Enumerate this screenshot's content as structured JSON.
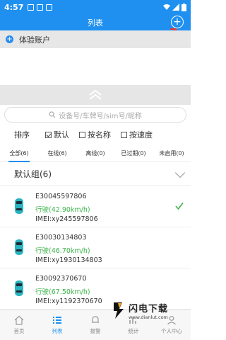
{
  "statusbar": {
    "time": "4:57"
  },
  "header": {
    "title": "列表",
    "add_icon": "plus-circle-icon"
  },
  "account": {
    "label": "体验账户"
  },
  "search": {
    "placeholder": "设备号/车牌号/sim号/昵称"
  },
  "sort": {
    "label": "排序",
    "options": [
      {
        "label": "默认",
        "checked": true
      },
      {
        "label": "按名称",
        "checked": false
      },
      {
        "label": "按速度",
        "checked": false
      }
    ]
  },
  "tabs": [
    {
      "label": "全部(6)",
      "active": true
    },
    {
      "label": "在线(6)",
      "active": false
    },
    {
      "label": "离线(0)",
      "active": false
    },
    {
      "label": "已过期(0)",
      "active": false
    },
    {
      "label": "未启用(0)",
      "active": false
    }
  ],
  "group": {
    "label": "默认组(6)"
  },
  "devices": [
    {
      "id": "E30045597806",
      "status": "行驶(42.90km/h)",
      "imei": "IMEI:xy245597806",
      "selected": true
    },
    {
      "id": "E30030134803",
      "status": "行驶(46.70km/h)",
      "imei": "IMEI:xy1930134803",
      "selected": false
    },
    {
      "id": "E30092370670",
      "status": "行驶(67.50km/h)",
      "imei": "IMEI:xy1192370670",
      "selected": false
    }
  ],
  "nav": [
    {
      "label": "首页",
      "icon": "home-icon",
      "active": false
    },
    {
      "label": "列表",
      "icon": "list-icon",
      "active": true
    },
    {
      "label": "报警",
      "icon": "alarm-icon",
      "active": false
    },
    {
      "label": "统计",
      "icon": "stats-icon",
      "active": false
    },
    {
      "label": "个人中心",
      "icon": "user-icon",
      "active": false
    }
  ],
  "watermark": {
    "big": "闪电下载",
    "small": "www.dianlut.com"
  },
  "colors": {
    "primary": "#1f90f0",
    "status_green": "#3bb54a",
    "accent_red": "#e53935"
  }
}
